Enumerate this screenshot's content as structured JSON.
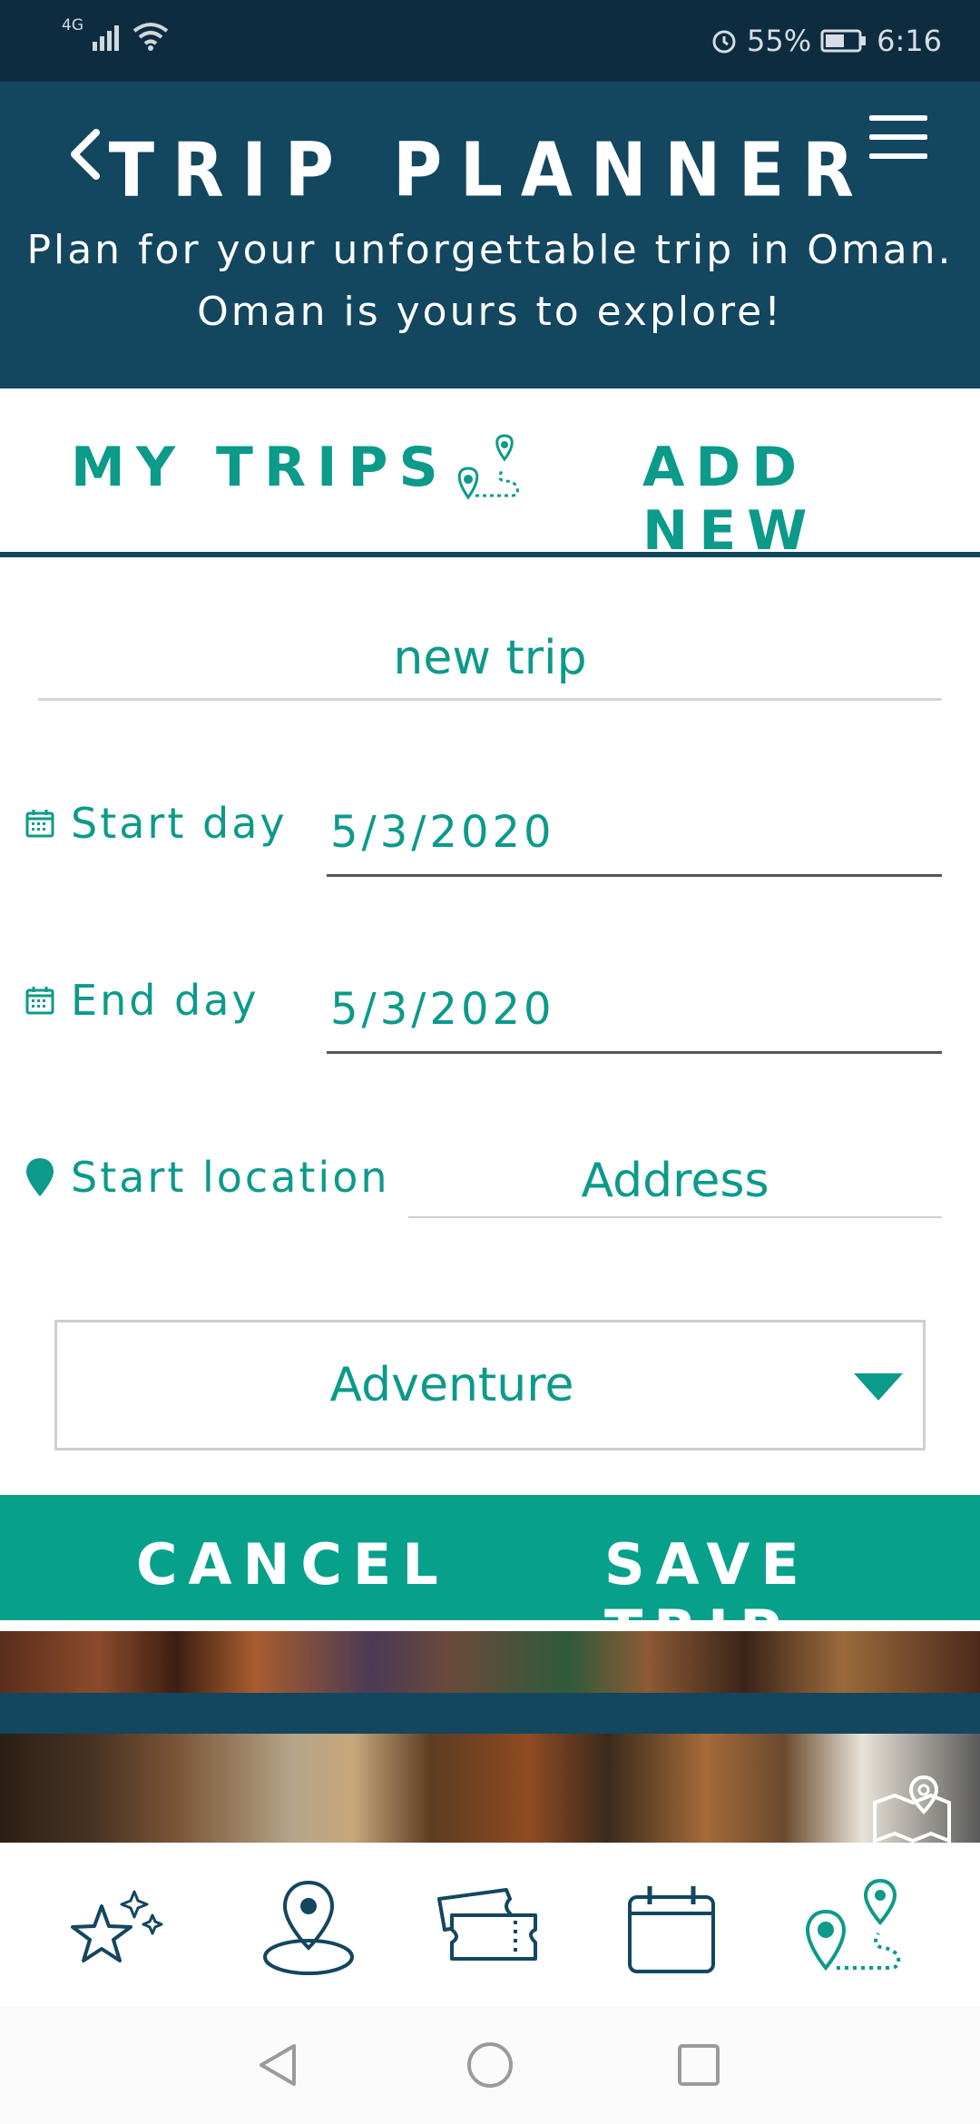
{
  "status_bar": {
    "network": "4G",
    "battery": "55%",
    "time": "6:16"
  },
  "header": {
    "title": "TRIP PLANNER",
    "subtitle_line1": "Plan for your unforgettable trip in Oman.",
    "subtitle_line2": "Oman is yours to explore!"
  },
  "tabs": {
    "my_trips": "MY TRIPS",
    "add_new": "ADD NEW"
  },
  "form": {
    "trip_name": "new trip",
    "start_label": "Start day",
    "start_value": "5/3/2020",
    "end_label": "End day",
    "end_value": "5/3/2020",
    "location_label": "Start location",
    "location_placeholder": "Address",
    "category": "Adventure"
  },
  "actions": {
    "cancel": "CANCEL",
    "save": "SAVE TRIP"
  },
  "colors": {
    "navy": "#13465f",
    "teal": "#0c9a8a",
    "action_bar": "#07a08b"
  },
  "bottom_nav_icons": [
    "sparkle-star-icon",
    "location-pin-icon",
    "ticket-icon",
    "calendar-icon",
    "trip-route-icon"
  ]
}
